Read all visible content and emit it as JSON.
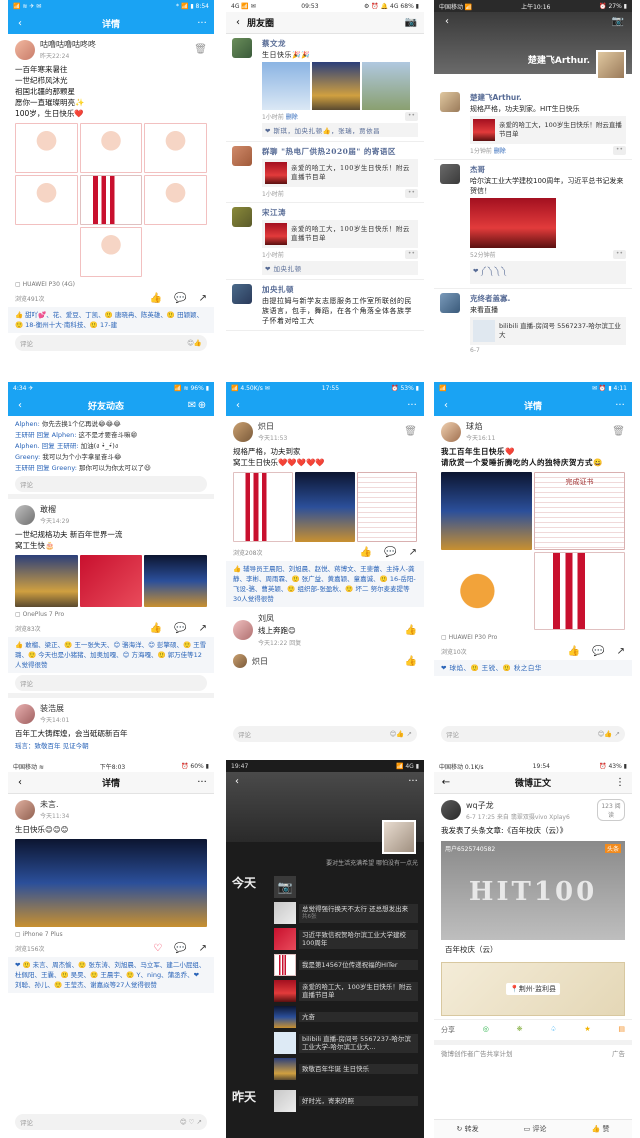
{
  "p1": {
    "status": {
      "left": "📶 ≋ ✈ ✉",
      "right": "* 📶 ▮ 8:54"
    },
    "nav": {
      "title": "详情",
      "more": "···"
    },
    "author": {
      "name": "咕噜咕噜咕咚咚",
      "time": "昨天22:24"
    },
    "lines": [
      "一百年寒来暑往",
      "一世纪栉风沐光",
      "祖国北疆的那颗星",
      "愿你一直璀璨明亮✨",
      "100岁，生日快乐❤️"
    ],
    "device": "HUAWEI P30 (4G)",
    "views": "浏览491次",
    "likes": "👍 甜吖💕、花、爱豆、丁凯、🙂 唐晓冉、陈英雄、🙂 田颖颖、🙂 18-衡州十大·南科技、🙂 17-建",
    "comment_placeholder": "评论"
  },
  "p2": {
    "status": {
      "left": "4G 📶 ✉",
      "mid": "09:53",
      "right": "⚙ ⏰ 🔔 4G 68% ▮"
    },
    "nav": {
      "title": "朋友圈"
    },
    "items": [
      {
        "name": "蔡文龙",
        "text": "生日快乐🎉🎉",
        "time": "1小时前",
        "del": "删除",
        "likes": "❤ 斯琪，加央扎顿👍，张瑞，贾依昌"
      },
      {
        "name": "群聊 \"热电厂供热2020届\" 的寄语区",
        "text": "亲爱的哈工大，100岁生日快乐！附云直播节目单",
        "time": "1小时前"
      },
      {
        "name": "宋江涛",
        "text": "亲爱的哈工大，100岁生日快乐！附云直播节目单",
        "time": "1小时前",
        "likes": "❤ 加央扎顿"
      },
      {
        "name": "加央扎顿",
        "text": "由提拉姆与新学友志愿服务工作室所联创的民族语言，包手，舞蹈，在各个角落全体各族学子怀着对哈工大"
      }
    ]
  },
  "p3": {
    "status": {
      "left": "中国移动 📶",
      "mid": "上午10:16",
      "right": "⏰ 27% ▮"
    },
    "nav": {
      "title": "楚建飞Arthur."
    },
    "items": [
      {
        "name": "楚建飞Arthur.",
        "text": "规格严格，功夫到家。HIT生日快乐",
        "card": "亲爱的哈工大，100岁生日快乐！附云直播节目单",
        "time": "1分钟前",
        "del": "删除"
      },
      {
        "name": "杰哥",
        "text": "哈尔滨工业大学建校100周年，习近平总书记发来贺信！",
        "time": "52分钟前",
        "likes": "❤ ༼ ༽ ༽ ༽"
      },
      {
        "name": "克终者盖寡.",
        "text": "来看直播",
        "card": "bilibili 直播-房间号 5567237-哈尔滨工业大",
        "time": "6-7"
      }
    ]
  },
  "p4": {
    "status": {
      "left": "4:34 ✈",
      "right": "📶 ≋ 96% ▮"
    },
    "nav": {
      "title": "好友动态"
    },
    "comments": [
      {
        "who": "Alphen:",
        "text": "你先去换1个亿再说😂😂😂"
      },
      {
        "who": "王研研 回复 Alphen:",
        "text": "这不是才要奋斗嘛😁"
      },
      {
        "who": "Alphen. 回复 王研研:",
        "text": "加油(ง •̀_•́)ง"
      },
      {
        "who": "Greeny:",
        "text": "我可以为个小字拿星奋斗😂"
      },
      {
        "who": "王研研 回复 Greeny:",
        "text": "那你可以为你太可以了😃"
      }
    ],
    "comment_placeholder": "评论",
    "author": {
      "name": "敢榴",
      "time": "今天14:29"
    },
    "lines": [
      "一世纪规格功夫 新百年世界一流",
      "窝工生快🎂"
    ],
    "device": "OnePlus 7 Pro",
    "views": "浏览83次",
    "likes": "👍 敢榴、梁正、🙂 王一张失天、😊 骆海洋、😊 彭擎硕、🙂 王雪璐、🙂 今天也是小猪猪、加奥加嘎、😊 方海嘎、🙂 郭万佳等12人觉得很赞",
    "author2": {
      "name": "装浩展",
      "time": "今天14:01"
    },
    "lines2": [
      "百年工大铸辉煌，会当砥砺新百年"
    ],
    "reply": "瑶言：致敬百年 见证今朝"
  },
  "p5": {
    "status": {
      "left": "📶 4.50K/s ✉",
      "mid": "17:55",
      "right": "⏰ 53% ▮"
    },
    "author": {
      "name": "炽日",
      "time": "今天11:53"
    },
    "lines": [
      "规格严格，功夫到家",
      "窝工生日快乐❤️❤️❤️❤️❤️"
    ],
    "views": "浏览208次",
    "likes": "👍 辅导员王晨阳、刘旭晨、赵悦、蒋博文、王斐蕾、主持人-龚静、李彬、周雨霖、🙂 张广益、黄嘉颖、童嘉诚、🙂 16-岳阳-飞设-骆、曹英颖、🙂 组织部-张盈秋、🙂 坏二 努尔麦麦提等30人觉得很赞",
    "c1": {
      "name": "刘凤",
      "text": "线上奔跑😊",
      "time": "今天12:22",
      "reply": "回复"
    },
    "c2": {
      "name": "炽日"
    },
    "comment_placeholder": "评论"
  },
  "p6": {
    "status": {
      "left": "📶",
      "right": "✉ ⏰ ▮ 4:11"
    },
    "nav": {
      "title": "详情",
      "more": "···"
    },
    "author": {
      "name": "球焰",
      "time": "今天16:11"
    },
    "lines": [
      "我工百年生日快乐❤️",
      "请欣赏一个爱睡折腾吃的人的独特庆贺方式😀"
    ],
    "cert_title": "完成证书",
    "device": "HUAWEI P30 Pro",
    "views": "浏览10次",
    "likes": "❤ 球焰、🙂 王锐、🙂 秋之白华",
    "comment_placeholder": "评论"
  },
  "p7": {
    "status": {
      "left": "中国移动 ≋",
      "mid": "下午8:03",
      "right": "⏰ 60% ▮"
    },
    "nav": {
      "title": "详情",
      "more": "···"
    },
    "author": {
      "name": "未言.",
      "time": "今天11:34"
    },
    "lines": [
      "生日快乐😊😊😊"
    ],
    "device": "iPhone 7 Plus",
    "views": "浏览156次",
    "likes": "❤ 🙂 未言、周杰愉、🙂 张东涛、刘旭晨、马立军、建二小屁组、杜佩阳、王囊、🙂 吴昊、🙂 王晨宇、🙂 Y、ning、蒲丞乔、❤ 刘聪、孙儿、🙂 王莹杰、谢嘉焱等27人觉得很赞",
    "comment_placeholder": "评论"
  },
  "p8": {
    "status": {
      "left": "19:47",
      "right": "📶 4G ▮"
    },
    "banner_text": "要对生活充满希望 哪怕没有一点光",
    "days": [
      {
        "day": "今天",
        "items": [
          {
            "text": "总觉得强行换天不太行 还总想发出来",
            "sub": "共6张"
          },
          {
            "text": "习近平致信祝贺哈尔滨工业大学建校100周年"
          },
          {
            "text": "我是第14567位传递祝福的HITer"
          },
          {
            "text": "亲爱的哈工大，100岁生日快乐！附云直播节目单"
          },
          {
            "text": "亢奋"
          },
          {
            "text": "bilibili 直播-房间号 5567237-哈尔滨工业大学-哈尔滨工业大..."
          },
          {
            "text": "致敬百年华诞 生日快乐"
          }
        ]
      },
      {
        "day": "昨天",
        "items": [
          {
            "text": "好时光，寄来的照"
          }
        ]
      }
    ]
  },
  "p9": {
    "status": {
      "left": "中国移动 0.1K/s",
      "mid": "19:54",
      "right": "⏰ 43% ▮"
    },
    "nav": {
      "title": "微博正文"
    },
    "author": {
      "name": "wq子龙",
      "time": "6-7 17:25 来自 翡翠双摄vivo Xplay6",
      "badge": "123 阅读"
    },
    "lines": [
      "我发表了头条文章:《百年校庆（云）》"
    ],
    "card_user": "用户6525740582",
    "card_tag": "头条",
    "card_big": "HIT100",
    "card_title": "百年校庆（云）",
    "location": "荆州·监利县",
    "share_label": "分享",
    "ad": "微博创作者广告共享计划",
    "ad_tag": "广告",
    "tabs": [
      "转发",
      "评论",
      "赞"
    ]
  }
}
